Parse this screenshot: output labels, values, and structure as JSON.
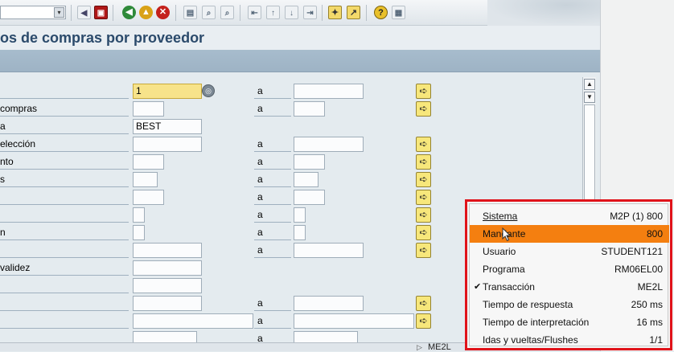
{
  "toolbar": {
    "icons": [
      "dropdown-arrow-icon",
      "back-arrow-icon",
      "save-icon",
      "green-back-icon",
      "exit-icon",
      "cancel-icon",
      "print-icon",
      "find-icon",
      "find-next-icon",
      "first-page-icon",
      "prev-page-icon",
      "next-page-icon",
      "last-page-icon",
      "new-session-icon",
      "shortcut-icon",
      "help-icon",
      "layout-icon"
    ]
  },
  "title": "os de compras por proveedor",
  "form": {
    "to_label": "a",
    "rows": [
      {
        "label": "",
        "value": "1",
        "to_value": ""
      },
      {
        "label": "compras",
        "value": "",
        "to_value": ""
      },
      {
        "label": "a",
        "value": "BEST"
      },
      {
        "label": "elección",
        "value": "",
        "to_value": ""
      },
      {
        "label": "nto",
        "value": "",
        "to_value": ""
      },
      {
        "label": "s",
        "value": "",
        "to_value": ""
      },
      {
        "label": "",
        "value": "",
        "to_value": ""
      },
      {
        "label": "",
        "value": "",
        "to_value": ""
      },
      {
        "label": "n",
        "value": "",
        "to_value": ""
      },
      {
        "label": "",
        "value": "",
        "to_value": ""
      },
      {
        "label": "validez",
        "value": ""
      },
      {
        "label": "",
        "value": ""
      },
      {
        "label": "",
        "value": "",
        "to_value": ""
      },
      {
        "label": "",
        "value": "",
        "to_value": ""
      },
      {
        "label": "",
        "value": "",
        "to_value": ""
      }
    ]
  },
  "status": {
    "code": "ME2L"
  },
  "system_menu": {
    "items": [
      {
        "label": "Sistema",
        "value": "M2P (1) 800"
      },
      {
        "label": "Mandante",
        "value": "800"
      },
      {
        "label": "Usuario",
        "value": "STUDENT121"
      },
      {
        "label": "Programa",
        "value": "RM06EL00"
      },
      {
        "label": "Transacción",
        "value": "ME2L"
      },
      {
        "label": "Tiempo de respuesta",
        "value": "250 ms"
      },
      {
        "label": "Tiempo de interpretación",
        "value": "16 ms"
      },
      {
        "label": "Idas y vueltas/Flushes",
        "value": "1/1"
      }
    ]
  },
  "colors": {
    "accent_title": "#2b4a6b",
    "required_field": "#f7e38a",
    "highlight": "#f47f10",
    "popup_frame": "#e0131a"
  }
}
